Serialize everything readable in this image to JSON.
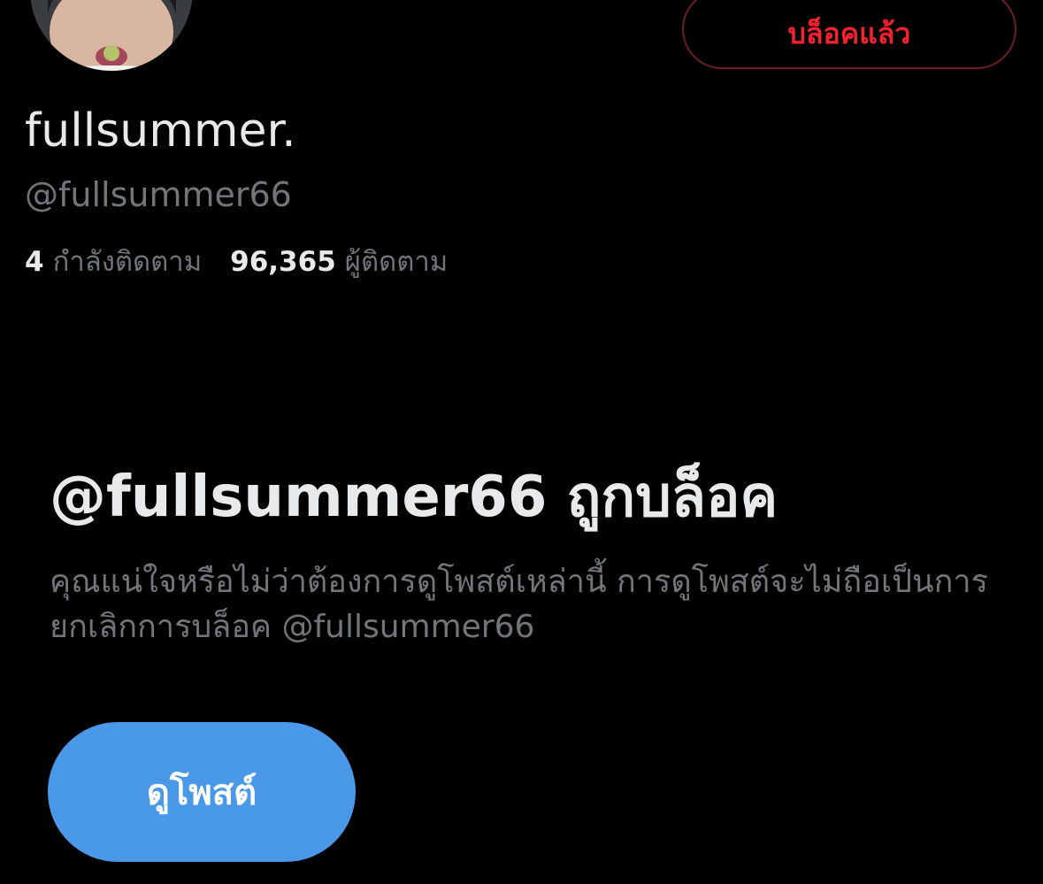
{
  "profile": {
    "display_name": "fullsummer.",
    "handle": "@fullsummer66",
    "avatar_icon": "profile-photo"
  },
  "header": {
    "blocked_button_label": "บล็อคแล้ว"
  },
  "stats": {
    "following_count": "4",
    "following_label": "กำลังติดตาม",
    "followers_count": "96,365",
    "followers_label": "ผู้ติดตาม"
  },
  "block_notice": {
    "title": "@fullsummer66 ถูกบล็อค",
    "description": "คุณแน่ใจหรือไม่ว่าต้องการดูโพสต์เหล่านี้ การดูโพสต์จะไม่ถือเป็นการยกเลิกการบล็อค @fullsummer66",
    "view_posts_label": "ดูโพสต์"
  },
  "colors": {
    "background": "#000000",
    "primary_text": "#e7e9ea",
    "secondary_text": "#71767b",
    "blocked_red": "#f4212e",
    "button_blue": "#4a99e9"
  }
}
